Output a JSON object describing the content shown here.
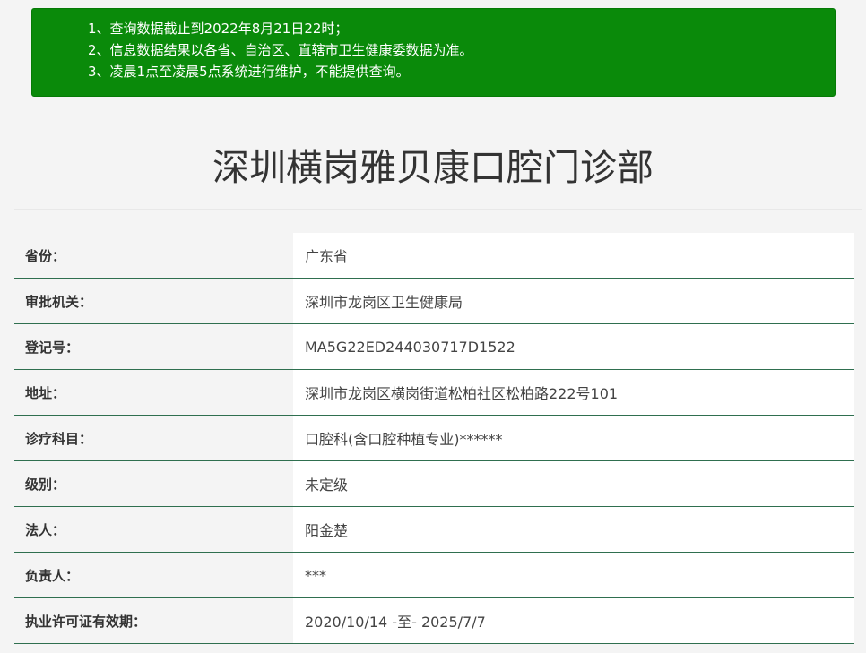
{
  "notice": {
    "lines": [
      "1、查询数据截止到2022年8月21日22时；",
      "2、信息数据结果以各省、自治区、直辖市卫生健康委数据为准。",
      "3、凌晨1点至凌晨5点系统进行维护，不能提供查询。"
    ],
    "background_color": "#0a8a0a"
  },
  "title": "深圳横岗雅贝康口腔门诊部",
  "rows": [
    {
      "label": "省份：",
      "value": "广东省"
    },
    {
      "label": "审批机关：",
      "value": "深圳市龙岗区卫生健康局"
    },
    {
      "label": "登记号：",
      "value": "MA5G22ED244030717D1522"
    },
    {
      "label": "地址：",
      "value": "深圳市龙岗区横岗街道松柏社区松柏路222号101"
    },
    {
      "label": "诊疗科目：",
      "value": "口腔科(含口腔种植专业)******"
    },
    {
      "label": "级别：",
      "value": "未定级"
    },
    {
      "label": "法人：",
      "value": "阳金楚"
    },
    {
      "label": "负责人：",
      "value": "***"
    },
    {
      "label": "执业许可证有效期：",
      "value": "2020/10/14 -至- 2025/7/7"
    }
  ]
}
